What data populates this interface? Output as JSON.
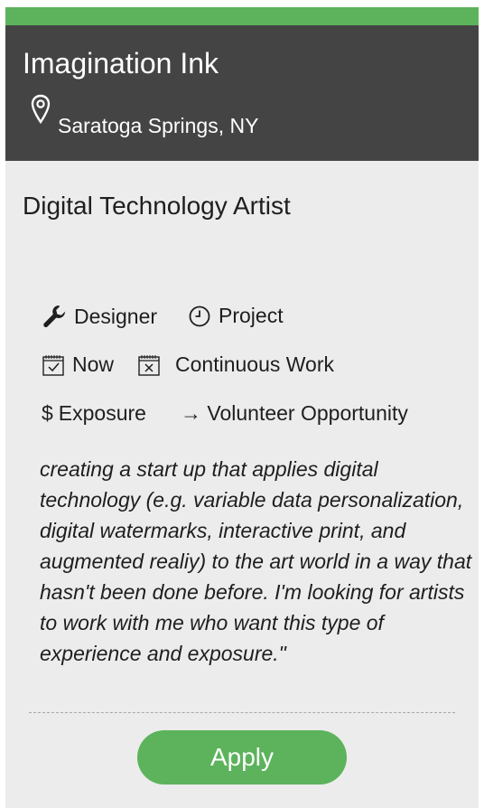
{
  "header": {
    "company": "Imagination Ink",
    "location": "Saratoga Springs, NY",
    "location_icon": "map-pin-icon"
  },
  "job": {
    "title": "Digital Technology Artist",
    "role": "Designer",
    "type": "Project",
    "start": "Now",
    "duration": "Continuous Work",
    "compensation": "Exposure",
    "category": "→ Volunteer Opportunity",
    "description": "creating a start up that applies digital technology (e.g. variable data personalization, digital watermarks, interactive print, and augmented realiy) to the art world in a way that hasn't been done before. I'm looking for artists to work with me who want this type of experience and exposure.\""
  },
  "actions": {
    "apply_label": "Apply"
  },
  "colors": {
    "accent": "#5cb35c",
    "header_bg": "#444444",
    "card_bg": "#ececec"
  }
}
